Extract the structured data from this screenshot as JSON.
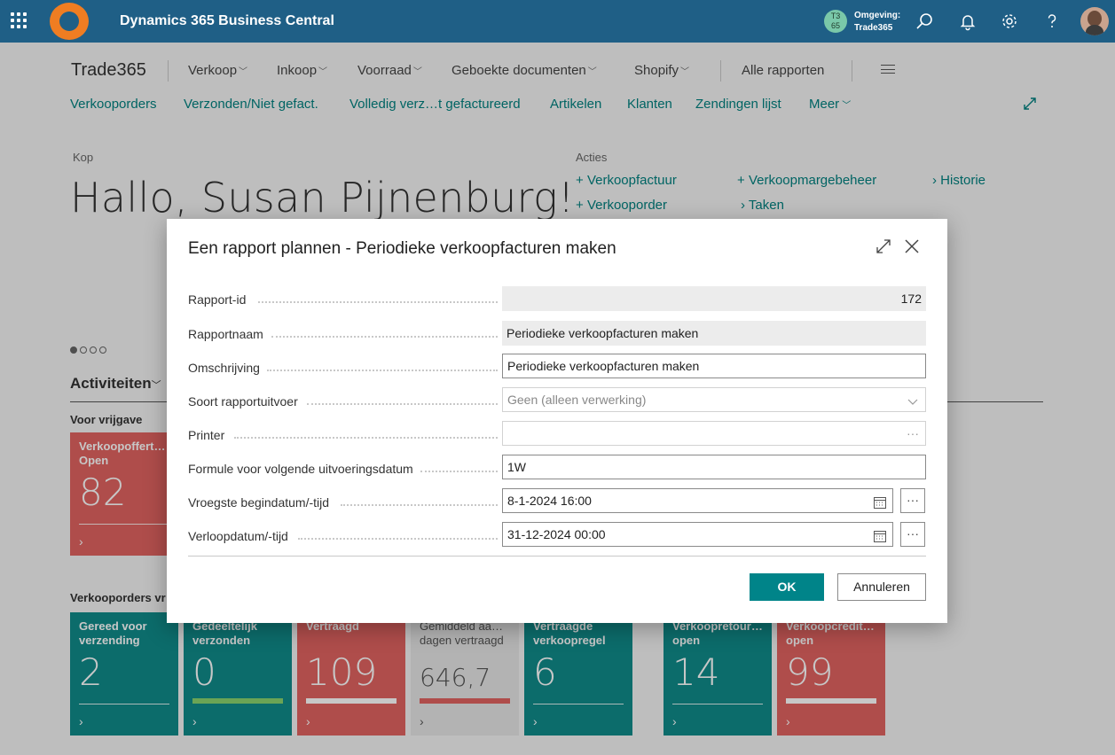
{
  "topbar": {
    "app_title": "Dynamics 365 Business Central",
    "env_avatar_line1": "T3",
    "env_avatar_line2": "65",
    "env_label": "Omgeving:",
    "env_value": "Trade365"
  },
  "nav": {
    "company": "Trade365",
    "menus": [
      "Verkoop",
      "Inkoop",
      "Voorraad",
      "Geboekte documenten",
      "Shopify"
    ],
    "all_reports": "Alle rapporten",
    "sub_links": [
      "Verkooporders",
      "Verzonden/Niet gefact.",
      "Volledig verz…t gefactureerd",
      "Artikelen",
      "Klanten",
      "Zendingen lijst",
      "Meer"
    ]
  },
  "headline": {
    "kop_label": "Kop",
    "greeting": "Hallo, Susan Pijnenburg!",
    "actions_label": "Acties",
    "actions": [
      "Verkoopfactuur",
      "Verkooporder",
      "Verkoopmargebeheer",
      "Taken",
      "Historie"
    ]
  },
  "activities": {
    "title": "Activiteiten",
    "group1_label": "Voor vrijgave",
    "group2_label": "Verkooporders vr",
    "tile_quotes": {
      "label": "Verkoopoffert…\nOpen",
      "value": "82"
    },
    "tiles": [
      {
        "label": "Gereed voor\nverzending",
        "value": "2"
      },
      {
        "label": "Gedeeltelijk\nverzonden",
        "value": "0"
      },
      {
        "label": "Vertraagd",
        "value": "109"
      },
      {
        "label": "Gemiddeld aa…\ndagen vertraagd",
        "value": "646,7"
      },
      {
        "label": "Vertraagde\nverkoopregel",
        "value": "6"
      },
      {
        "label": "Verkoopretour…\nopen",
        "value": "14"
      },
      {
        "label": "Verkoopcredit…\nopen",
        "value": "99"
      }
    ]
  },
  "dialog": {
    "title": "Een rapport plannen - Periodieke verkoopfacturen maken",
    "fields": {
      "report_id": {
        "label": "Rapport-id",
        "value": "172"
      },
      "report_name": {
        "label": "Rapportnaam",
        "value": "Periodieke verkoopfacturen maken"
      },
      "description": {
        "label": "Omschrijving",
        "value": "Periodieke verkoopfacturen maken"
      },
      "output_type": {
        "label": "Soort rapportuitvoer",
        "value": "Geen (alleen verwerking)"
      },
      "printer": {
        "label": "Printer",
        "value": ""
      },
      "formula": {
        "label": "Formule voor volgende uitvoeringsdatum",
        "value": "1W"
      },
      "earliest_start": {
        "label": "Vroegste begindatum/-tijd",
        "value": "8-1-2024 16:00"
      },
      "expiration": {
        "label": "Verloopdatum/-tijd",
        "value": "31-12-2024 00:00"
      }
    },
    "more_glyph": "···",
    "ok_label": "OK",
    "cancel_label": "Annuleren"
  },
  "colors": {
    "topbar": "#1f5f86",
    "accent_teal": "#008489",
    "tile_teal": "#108b8a",
    "tile_red": "#e16360",
    "logo_orange": "#ef7d22"
  }
}
